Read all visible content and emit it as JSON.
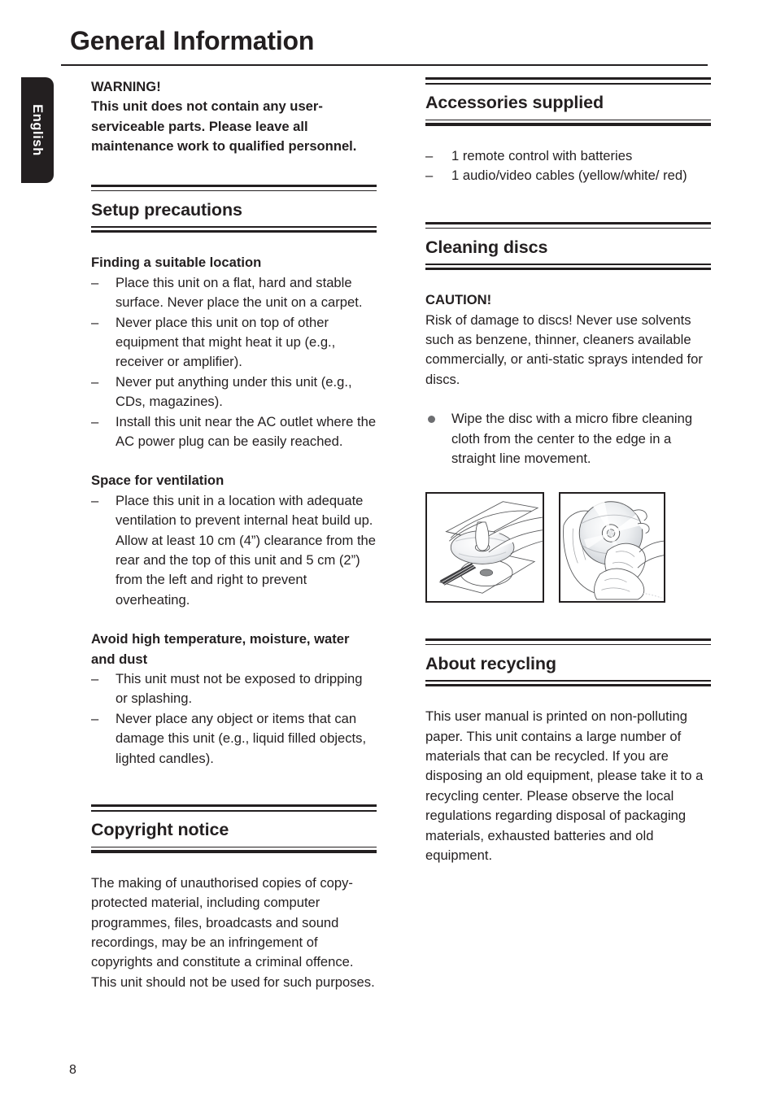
{
  "page": {
    "title": "General Information",
    "language_tab": "English",
    "page_number": "8"
  },
  "left_column": {
    "warning": {
      "heading": "WARNING!",
      "text": "This unit does not contain any user-serviceable parts. Please leave all maintenance work to qualified personnel."
    },
    "setup_precautions": {
      "title": "Setup precautions",
      "subsections": [
        {
          "heading": "Finding a suitable location",
          "items": [
            "Place this unit on a flat, hard and stable surface. Never place the unit on a carpet.",
            "Never place this unit on top of other equipment that might heat it up (e.g., receiver or amplifier).",
            "Never put anything under this unit (e.g., CDs, magazines).",
            "Install this unit near the AC outlet where the AC power plug can be easily reached."
          ]
        },
        {
          "heading": "Space for ventilation",
          "items": [
            "Place this unit in a location with adequate ventilation to prevent internal heat build up. Allow at least 10 cm (4”) clearance from the rear and the top of this unit and 5 cm (2”) from the left and right to prevent overheating."
          ]
        },
        {
          "heading": "Avoid high temperature, moisture, water and dust",
          "items": [
            "This unit must not be exposed to dripping or splashing.",
            "Never place any object or items that can damage this unit (e.g., liquid filled objects, lighted candles)."
          ]
        }
      ]
    },
    "copyright_notice": {
      "title": "Copyright notice",
      "text": "The making of unauthorised copies of copy-protected material, including computer programmes, files, broadcasts and sound recordings, may be an infringement of copyrights and constitute a criminal offence. This unit should not be used for such purposes."
    }
  },
  "right_column": {
    "accessories_supplied": {
      "title": "Accessories supplied",
      "items": [
        "1 remote control with batteries",
        "1 audio/video cables (yellow/white/ red)"
      ]
    },
    "cleaning_discs": {
      "title": "Cleaning discs",
      "caution_heading": "CAUTION!",
      "caution_text": "Risk of damage to discs! Never use solvents such as benzene, thinner, cleaners available commercially, or anti-static sprays intended for discs.",
      "bullet": "Wipe the disc with a micro fibre cleaning cloth from the center to the edge in a straight line movement.",
      "figures": [
        {
          "name": "disc-removal-from-case-illustration"
        },
        {
          "name": "disc-wiping-with-cloth-illustration"
        }
      ]
    },
    "about_recycling": {
      "title": "About recycling",
      "text": "This user manual is printed on non-polluting paper. This unit contains a large number of materials that can be recycled. If you are disposing an old equipment, please take it to a recycling center. Please observe the local regulations regarding disposal of packaging materials, exhausted batteries and old equipment."
    }
  },
  "symbols": {
    "dash": "–"
  }
}
